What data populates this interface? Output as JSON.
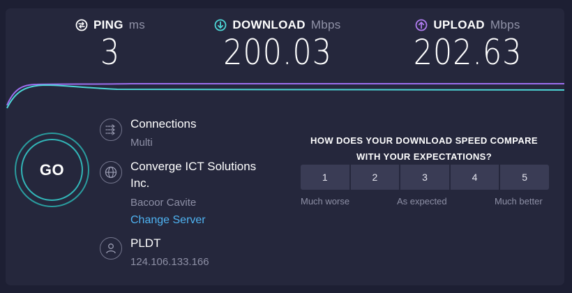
{
  "metrics": {
    "ping": {
      "label": "PING",
      "unit": "ms",
      "value": "3",
      "icon": "ping-gauge-icon",
      "color": "#ffffff"
    },
    "download": {
      "label": "DOWNLOAD",
      "unit": "Mbps",
      "value": "200.03",
      "icon": "arrow-down-circle-icon",
      "color": "#4dd6d6"
    },
    "upload": {
      "label": "UPLOAD",
      "unit": "Mbps",
      "value": "202.63",
      "icon": "arrow-up-circle-icon",
      "color": "#b07cf0"
    }
  },
  "graph": {
    "download_color": "#4dd6d6",
    "upload_color": "#9d6ff0"
  },
  "go_button": {
    "label": "GO"
  },
  "connections": {
    "title": "Connections",
    "value": "Multi",
    "icon": "connections-arrows-icon"
  },
  "server": {
    "name_line1": "Converge ICT Solutions",
    "name_line2": "Inc.",
    "location": "Bacoor Cavite",
    "change_link": "Change Server",
    "icon": "globe-icon"
  },
  "provider": {
    "name": "PLDT",
    "ip": "124.106.133.166",
    "icon": "user-icon"
  },
  "feedback": {
    "question_line1": "HOW DOES YOUR DOWNLOAD SPEED COMPARE",
    "question_line2": "WITH YOUR EXPECTATIONS?",
    "ratings": [
      "1",
      "2",
      "3",
      "4",
      "5"
    ],
    "low_label": "Much worse",
    "mid_label": "As expected",
    "high_label": "Much better"
  },
  "colors": {
    "background": "#1d1f33",
    "panel": "#25273c",
    "accent_teal": "#32b6b8",
    "link": "#4fb3f2"
  }
}
